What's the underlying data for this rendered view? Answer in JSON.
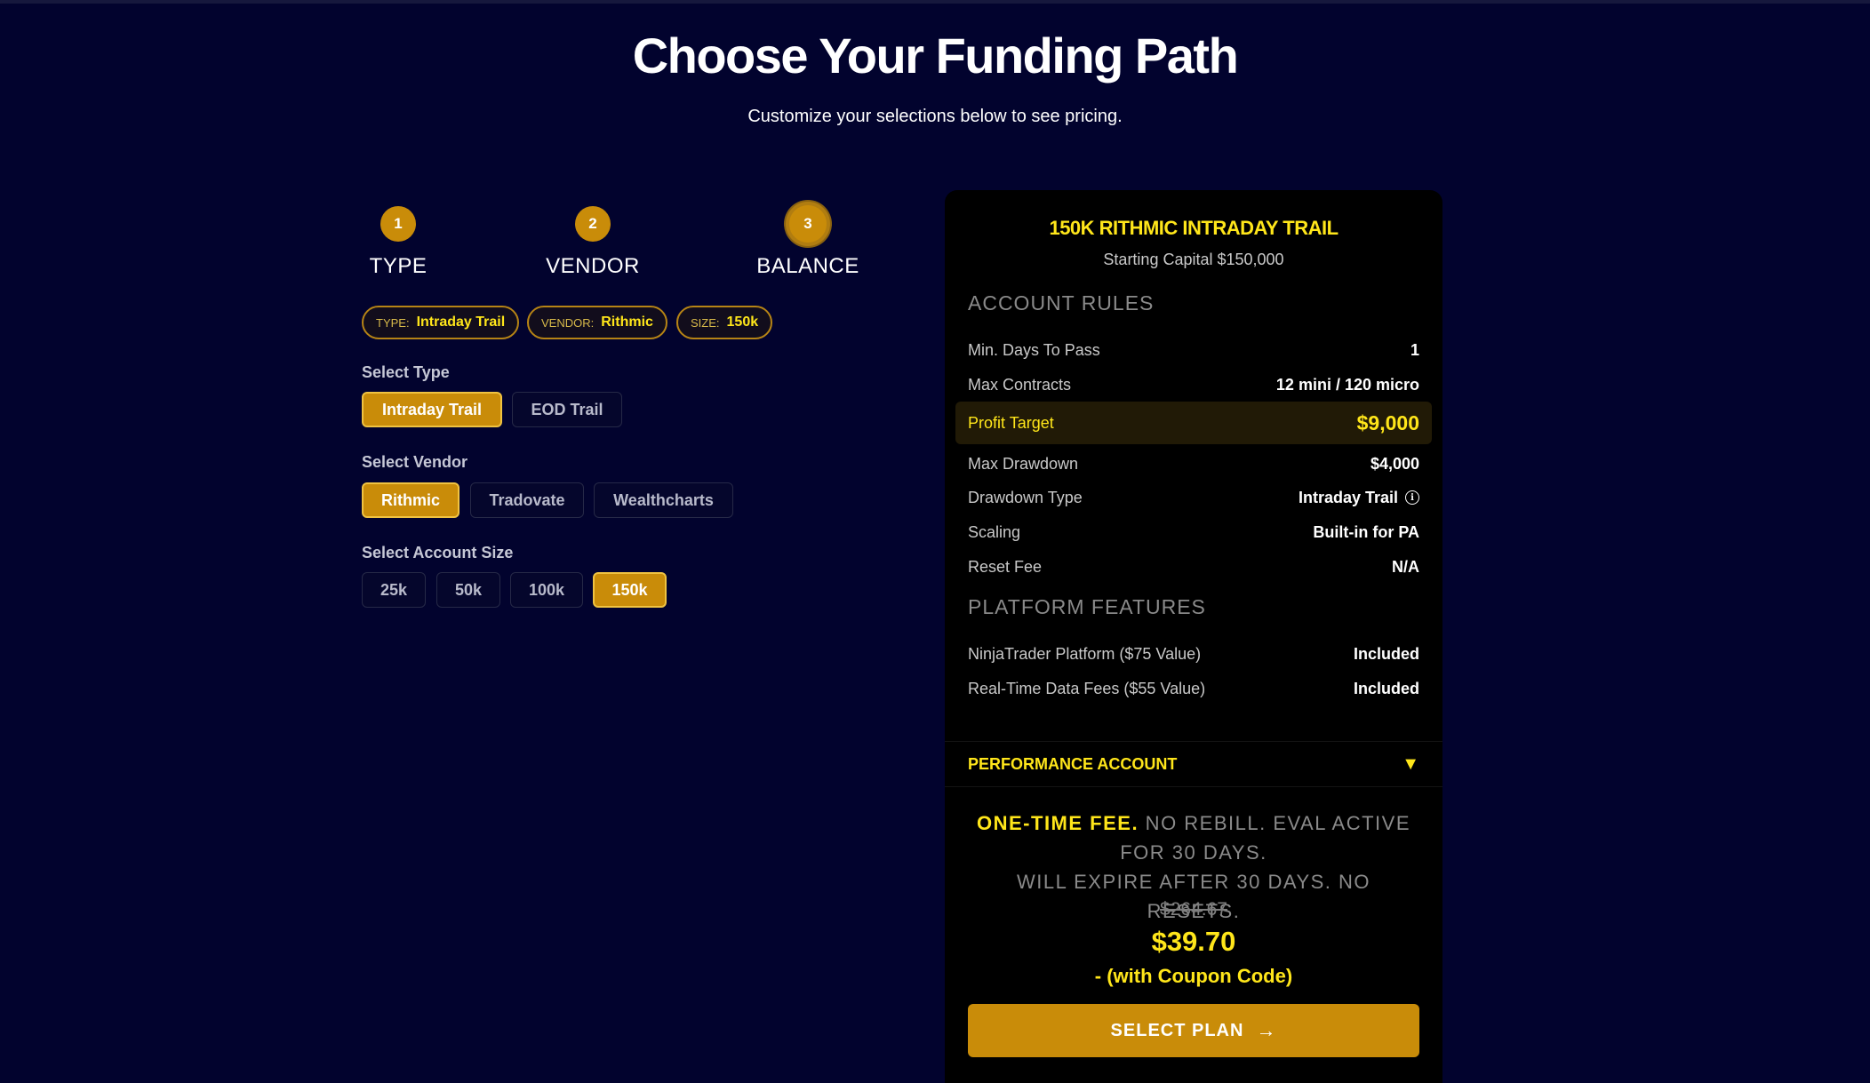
{
  "header": {
    "title": "Choose Your Funding Path",
    "subtitle": "Customize your selections below to see pricing."
  },
  "steps": [
    {
      "number": "1",
      "label": "TYPE"
    },
    {
      "number": "2",
      "label": "VENDOR"
    },
    {
      "number": "3",
      "label": "BALANCE"
    }
  ],
  "summary_pills": [
    {
      "key": "TYPE:",
      "value": "Intraday Trail"
    },
    {
      "key": "VENDOR:",
      "value": "Rithmic"
    },
    {
      "key": "SIZE:",
      "value": "150k"
    }
  ],
  "select_type": {
    "label": "Select Type",
    "options": [
      "Intraday Trail",
      "EOD Trail"
    ],
    "selected": "Intraday Trail"
  },
  "select_vendor": {
    "label": "Select Vendor",
    "options": [
      "Rithmic",
      "Tradovate",
      "Wealthcharts"
    ],
    "selected": "Rithmic"
  },
  "select_size": {
    "label": "Select Account Size",
    "options": [
      "25k",
      "50k",
      "100k",
      "150k"
    ],
    "selected": "150k"
  },
  "card": {
    "title": "150K RITHMIC INTRADAY TRAIL",
    "subtitle": "Starting Capital $150,000",
    "account_rules_heading": "ACCOUNT RULES",
    "rules": [
      {
        "label": "Min. Days To Pass",
        "value": "1"
      },
      {
        "label": "Max Contracts",
        "value": "12 mini / 120 micro"
      },
      {
        "label": "Profit Target",
        "value": "$9,000"
      },
      {
        "label": "Max Drawdown",
        "value": "$4,000"
      },
      {
        "label": "Drawdown Type",
        "value": "Intraday Trail"
      },
      {
        "label": "Scaling",
        "value": "Built-in for PA"
      },
      {
        "label": "Reset Fee",
        "value": "N/A"
      }
    ],
    "platform_heading": "PLATFORM FEATURES",
    "features": [
      {
        "label": "NinjaTrader Platform ($75 Value)",
        "value": "Included"
      },
      {
        "label": "Real-Time Data Fees ($55 Value)",
        "value": "Included"
      }
    ],
    "performance_label": "PERFORMANCE ACCOUNT",
    "performance_chevron": "▼",
    "fee_strong": "ONE-TIME FEE.",
    "fee_line1": " NO REBILL. EVAL ACTIVE FOR 30 DAYS.",
    "fee_line2": "WILL EXPIRE AFTER 30 DAYS. NO RESETS.",
    "old_price": "$264.67",
    "price": "$39.70",
    "coupon_note": "- (with Coupon Code)",
    "cta_label": "SELECT PLAN",
    "cta_arrow": "→"
  },
  "colors": {
    "background": "#02032e",
    "accent": "#c98c09",
    "highlight": "#ffe61a",
    "card": "#000000"
  }
}
